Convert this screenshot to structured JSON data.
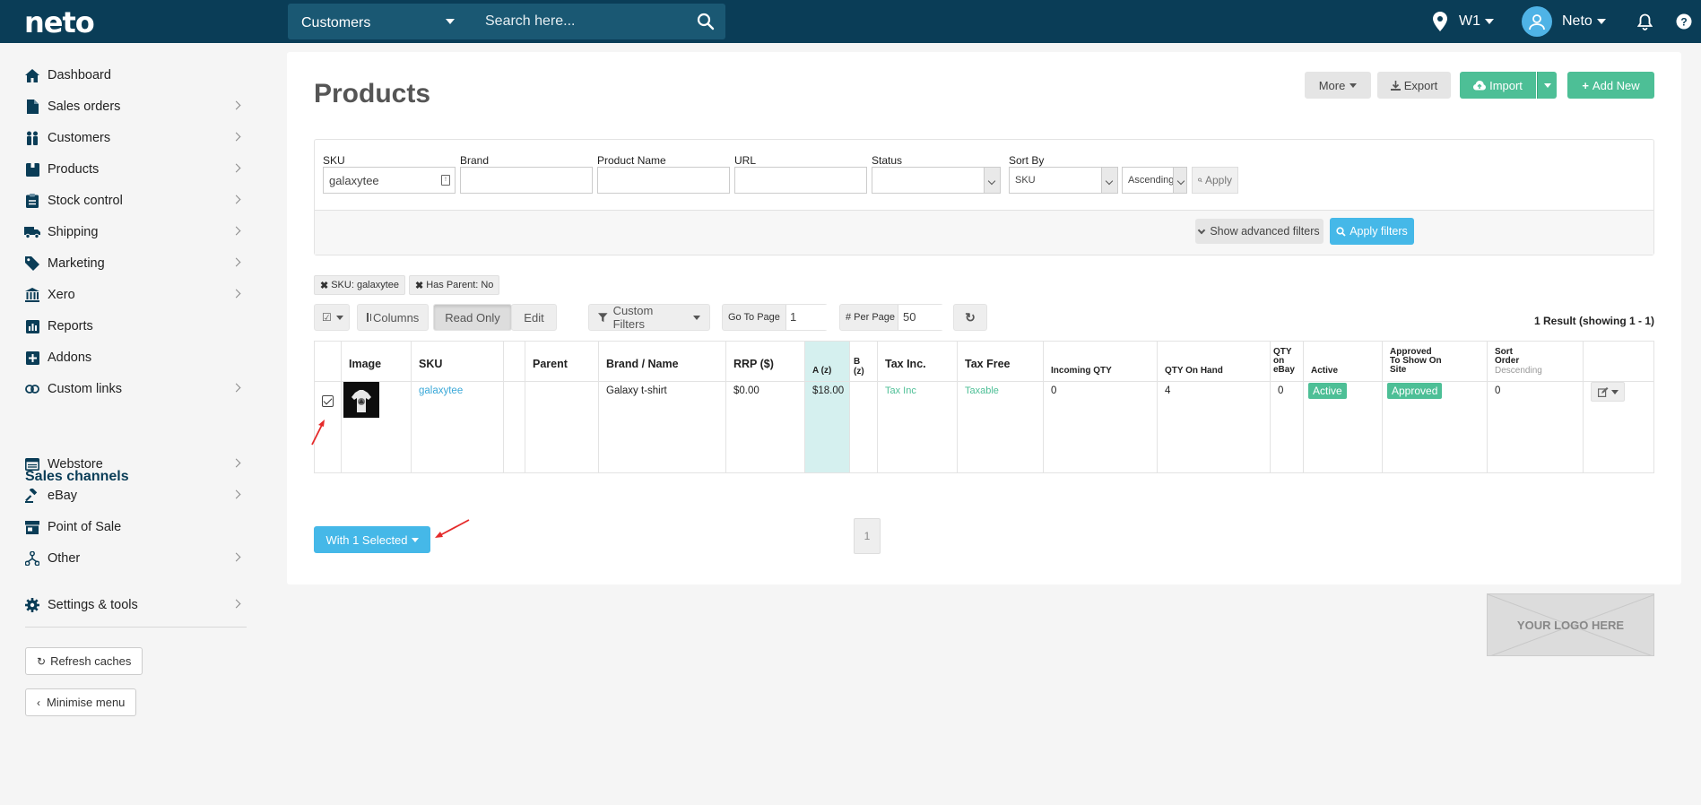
{
  "topbar": {
    "logo": "neto",
    "search_category": "Customers",
    "search_placeholder": "Search here...",
    "location": "W1",
    "user": "Neto"
  },
  "sidebar": {
    "items": [
      {
        "label": "Dashboard",
        "icon": "home-icon"
      },
      {
        "label": "Sales orders",
        "icon": "document-icon"
      },
      {
        "label": "Customers",
        "icon": "users-icon"
      },
      {
        "label": "Products",
        "icon": "box-icon"
      },
      {
        "label": "Stock control",
        "icon": "clipboard-icon"
      },
      {
        "label": "Shipping",
        "icon": "truck-icon"
      },
      {
        "label": "Marketing",
        "icon": "tag-icon"
      },
      {
        "label": "Xero",
        "icon": "bank-icon"
      },
      {
        "label": "Reports",
        "icon": "chart-icon"
      },
      {
        "label": "Addons",
        "icon": "plus-square-icon"
      },
      {
        "label": "Custom links",
        "icon": "link-icon"
      }
    ],
    "channels_heading": "Sales channels",
    "channels": [
      {
        "label": "Webstore",
        "icon": "browser-icon"
      },
      {
        "label": "eBay",
        "icon": "gavel-icon"
      },
      {
        "label": "Point of Sale",
        "icon": "store-icon"
      },
      {
        "label": "Other",
        "icon": "sitemap-icon"
      }
    ],
    "settings": "Settings & tools",
    "refresh": "Refresh caches",
    "minimise": "Minimise menu"
  },
  "page": {
    "title": "Products",
    "more": "More",
    "export": "Export",
    "import": "Import",
    "add_new": "Add New"
  },
  "filters": {
    "sku_label": "SKU",
    "sku_value": "galaxytee",
    "brand_label": "Brand",
    "product_name_label": "Product Name",
    "url_label": "URL",
    "status_label": "Status",
    "sort_by_label": "Sort By",
    "sort_by_value": "SKU",
    "sort_dir_value": "Ascending",
    "apply": "Apply",
    "show_advanced": "Show advanced filters",
    "apply_filters": "Apply filters"
  },
  "chips": [
    "SKU: galaxytee",
    "Has Parent: No"
  ],
  "toolbar": {
    "columns": "Columns",
    "read_only": "Read Only",
    "edit": "Edit",
    "custom_filters": "Custom Filters",
    "go_to_page_label": "Go To Page",
    "go_to_page_value": "1",
    "per_page_label": "# Per Page",
    "per_page_value": "50",
    "results": "1 Result (showing 1 - 1)"
  },
  "table": {
    "headers": {
      "image": "Image",
      "sku": "SKU",
      "parent": "Parent",
      "brand_name": "Brand / Name",
      "rrp": "RRP ($)",
      "a": "A (z)",
      "b": "B (z)",
      "tax_inc": "Tax Inc.",
      "tax_free": "Tax Free",
      "incoming": "Incoming QTY",
      "on_hand": "QTY On Hand",
      "ebay": "QTY on eBay",
      "active": "Active",
      "approved": "Approved To Show On Site",
      "sort_order": "Sort Order",
      "sort_order_sub": "Descending"
    },
    "row": {
      "sku": "galaxytee",
      "brand_name": "Galaxy t-shirt",
      "rrp": "$0.00",
      "a": "$18.00",
      "tax_inc": "Tax Inc",
      "tax_free": "Taxable",
      "incoming": "0",
      "on_hand": "4",
      "ebay": "0",
      "active": "Active",
      "approved": "Approved",
      "sort_order": "0"
    }
  },
  "bulk": {
    "with_selected": "With 1 Selected"
  },
  "pagination": {
    "current": "1"
  },
  "logo_placeholder": "YOUR LOGO HERE",
  "colors": {
    "topbar": "#0a3d57",
    "green": "#4dbf96",
    "blue": "#45b8e8",
    "highlight_col": "#d5f0ef"
  }
}
